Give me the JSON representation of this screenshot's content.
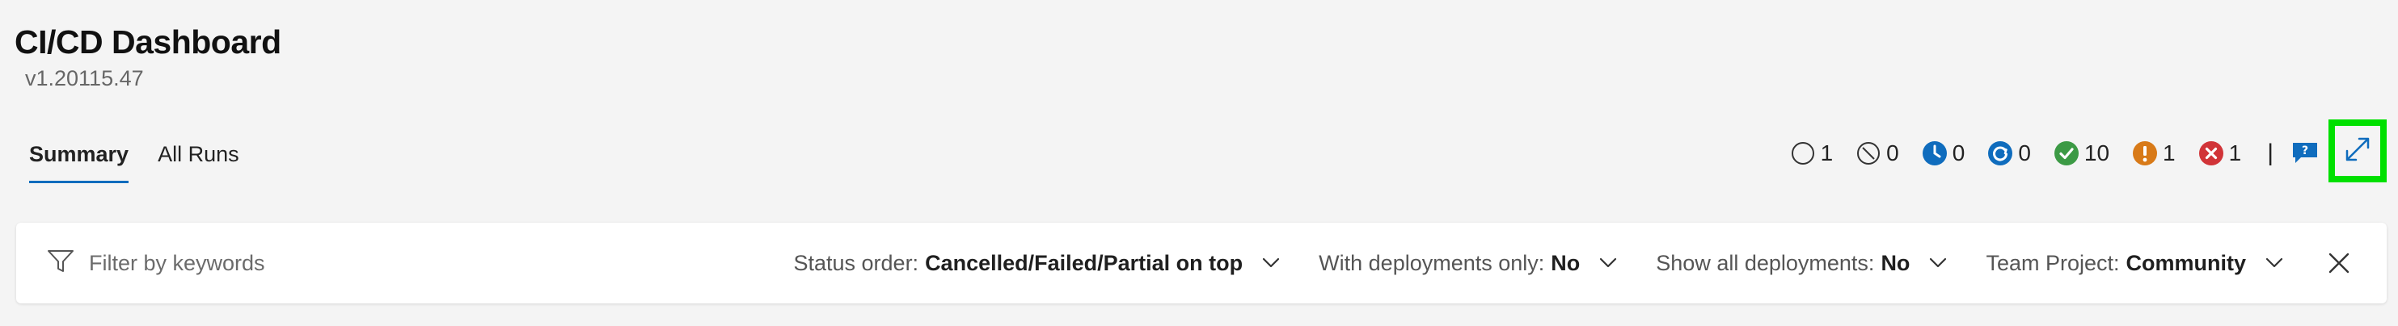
{
  "header": {
    "title": "CI/CD Dashboard",
    "version": "v1.20115.47"
  },
  "tabs": [
    {
      "label": "Summary",
      "active": true
    },
    {
      "label": "All Runs",
      "active": false
    }
  ],
  "status_counts": [
    {
      "icon": "not-started-icon",
      "count": "1",
      "color": "#333333"
    },
    {
      "icon": "skipped-icon",
      "count": "0",
      "color": "#333333"
    },
    {
      "icon": "queued-clock-icon",
      "count": "0",
      "color": "#0f6cbd"
    },
    {
      "icon": "in-progress-icon",
      "count": "0",
      "color": "#0f6cbd"
    },
    {
      "icon": "succeeded-check-icon",
      "count": "10",
      "color": "#3c9a45"
    },
    {
      "icon": "warning-icon",
      "count": "1",
      "color": "#d87a18"
    },
    {
      "icon": "failed-x-icon",
      "count": "1",
      "color": "#d13438"
    }
  ],
  "status_divider": "|",
  "filter": {
    "placeholder": "Filter by keywords",
    "status_order_label": "Status order:",
    "status_order_value": "Cancelled/Failed/Partial on top",
    "deployments_only_label": "With deployments only:",
    "deployments_only_value": "No",
    "show_all_deployments_label": "Show all deployments:",
    "show_all_deployments_value": "No",
    "team_project_label": "Team Project:",
    "team_project_value": "Community"
  },
  "colors": {
    "accent": "#0f6cbd",
    "highlight": "#00e000"
  }
}
